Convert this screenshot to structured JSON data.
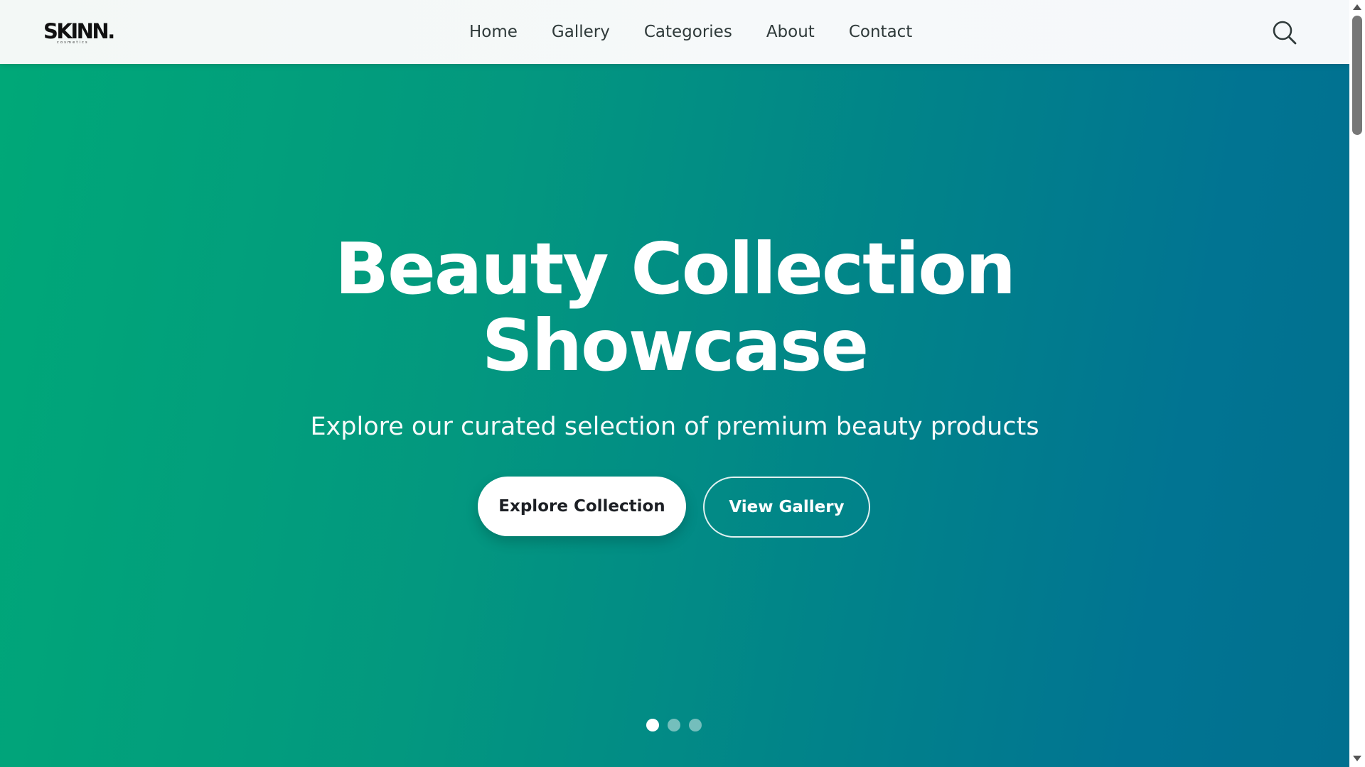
{
  "brand": {
    "logo_text": "SKINN.",
    "logo_subtext": "cosmetics"
  },
  "nav": {
    "items": [
      {
        "label": "Home"
      },
      {
        "label": "Gallery"
      },
      {
        "label": "Categories"
      },
      {
        "label": "About"
      },
      {
        "label": "Contact"
      }
    ],
    "search_icon": "search-icon"
  },
  "hero": {
    "title_line1": "Beauty Collection",
    "title_line2": "Showcase",
    "subtitle": "Explore our curated selection of premium beauty products",
    "primary_button": "Explore Collection",
    "secondary_button": "View Gallery",
    "slides_total": 3,
    "active_slide": 1,
    "gradient_start": "#00a878",
    "gradient_end": "#01708f"
  }
}
